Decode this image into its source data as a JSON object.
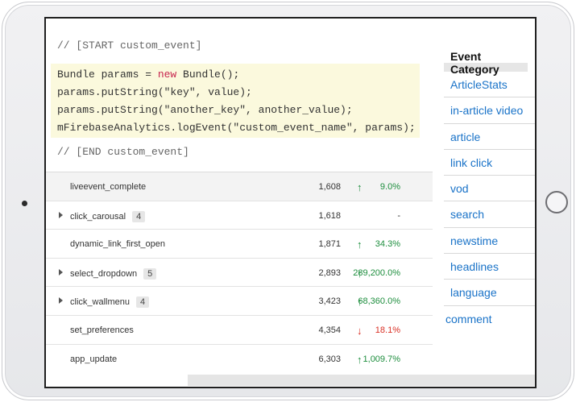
{
  "code": {
    "start_comment": "// [START custom_event]",
    "line1_a": "Bundle params = ",
    "line1_kw": "new",
    "line1_b": " Bundle();",
    "line2": "params.putString(\"key\", value);",
    "line3": "params.putString(\"another_key\", another_value);",
    "line4": "mFirebaseAnalytics.logEvent(\"custom_event_name\", params);",
    "end_comment": "// [END custom_event]"
  },
  "events": [
    {
      "name": "liveevent_complete",
      "count": "1,608",
      "trend": "up",
      "change": "9.0%"
    },
    {
      "name": "click_carousal",
      "badge": "4",
      "count": "1,618",
      "trend": "none",
      "change": "-"
    },
    {
      "name": "dynamic_link_first_open",
      "count": "1,871",
      "trend": "up",
      "change": "34.3%"
    },
    {
      "name": "select_dropdown",
      "badge": "5",
      "count": "2,893",
      "trend": "up",
      "change": "289,200.0%"
    },
    {
      "name": "click_wallmenu",
      "badge": "4",
      "count": "3,423",
      "trend": "up",
      "change": "68,360.0%"
    },
    {
      "name": "set_preferences",
      "count": "4,354",
      "trend": "down",
      "change": "18.1%"
    },
    {
      "name": "app_update",
      "count": "6,303",
      "trend": "up",
      "change": "1,009.7%"
    }
  ],
  "arrows": {
    "up": "↑",
    "down": "↓"
  },
  "category": {
    "title": "Event Category",
    "items": [
      "ArticleStats",
      "in-article video",
      "article",
      "link click",
      "vod",
      "search",
      "newstime",
      "headlines",
      "language",
      "comment"
    ]
  },
  "colors": {
    "up": "#1e8e3e",
    "down": "#d93025",
    "link": "#1a73c8",
    "code_highlight": "#fbf9dd"
  }
}
